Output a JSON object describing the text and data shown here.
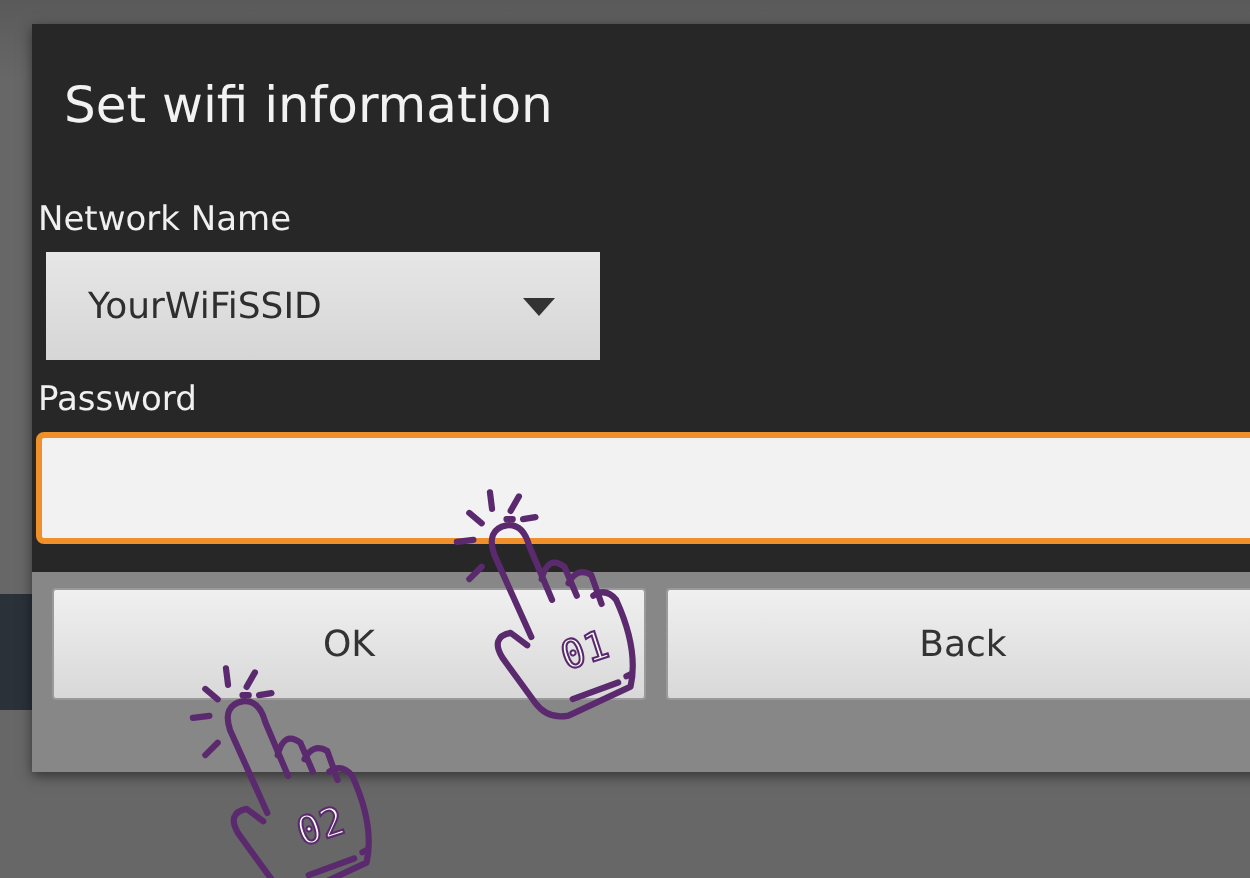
{
  "window": {
    "title": "Set wifi information"
  },
  "network": {
    "label": "Network Name",
    "value": "YourWiFiSSID"
  },
  "password": {
    "label": "Password",
    "focused": true
  },
  "buttons": [
    {
      "label": "OK"
    },
    {
      "label": "Back"
    }
  ],
  "annotations": [
    {
      "step": "01"
    },
    {
      "step": "02"
    }
  ]
}
